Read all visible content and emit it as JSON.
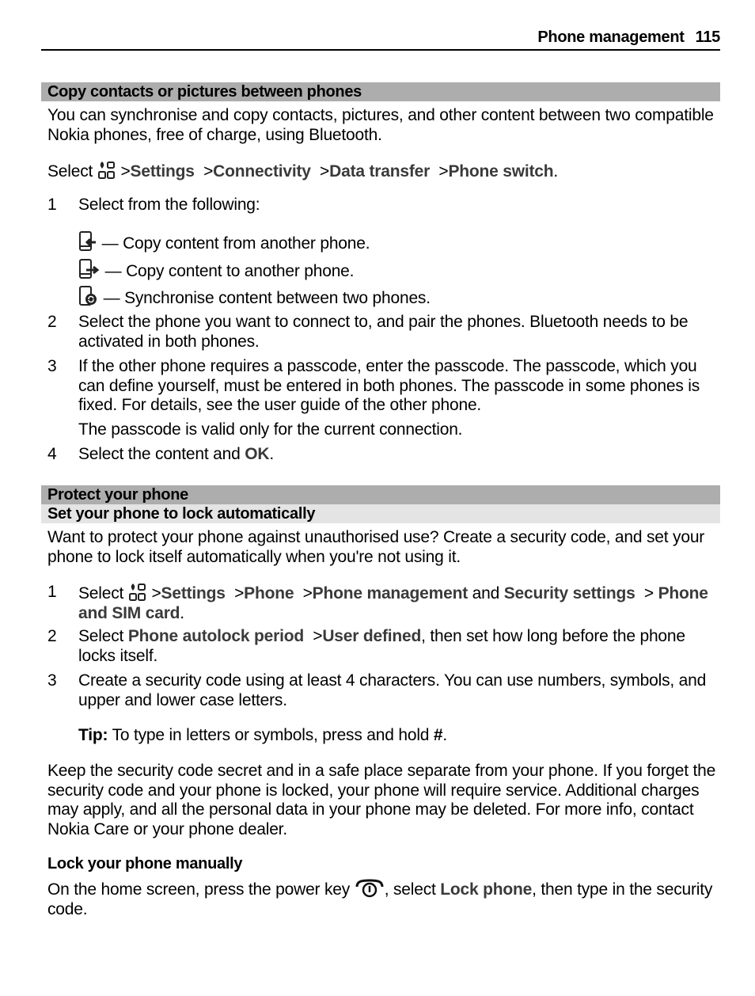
{
  "header": {
    "section": "Phone management",
    "page_number": "115"
  },
  "section1": {
    "title": "Copy contacts or pictures between phones",
    "intro": "You can synchronise and copy contacts, pictures, and other content between two compatible Nokia phones, free of charge, using Bluetooth.",
    "path": {
      "prefix": "Select",
      "icon": "menu-grid-icon",
      "items": [
        "Settings",
        "Connectivity",
        "Data transfer",
        "Phone switch"
      ],
      "suffix": "."
    },
    "steps": [
      {
        "n": "1",
        "text": "Select from the following:"
      },
      {
        "n": "2",
        "text": "Select the phone you want to connect to, and pair the phones. Bluetooth needs to be activated in both phones."
      },
      {
        "n": "3",
        "text": "If the other phone requires a passcode, enter the passcode. The passcode, which you can define yourself, must be entered in both phones. The passcode in some phones is fixed. For details, see the user guide of the other phone.",
        "note": "The passcode is valid only for the current connection."
      },
      {
        "n": "4",
        "text": "Select the content and ",
        "ui": "OK",
        "suffix": "."
      }
    ],
    "options": [
      {
        "icon": "copy-from-phone-icon",
        "text": "— Copy content from another phone."
      },
      {
        "icon": "copy-to-phone-icon",
        "text": "— Copy content to another phone."
      },
      {
        "icon": "sync-phones-icon",
        "text": "— Synchronise content between two phones."
      }
    ]
  },
  "section2": {
    "title": "Protect your phone",
    "subtitle": "Set your phone to lock automatically",
    "intro": "Want to protect your phone against unauthorised use? Create a security code, and set your phone to lock itself automatically when you're not using it.",
    "steps": [
      {
        "n": "1",
        "prefix": "Select",
        "items": [
          "Settings",
          "Phone",
          "Phone management"
        ],
        "and": "and",
        "item4": "Security settings",
        "item5": "Phone and SIM card",
        "suffix": "."
      },
      {
        "n": "2",
        "prefix": "Select",
        "item1": "Phone autolock period",
        "item2": "User defined",
        "text": ", then set how long before the phone locks itself."
      },
      {
        "n": "3",
        "text": "Create a security code using at least 4 characters. You can use numbers, symbols, and upper and lower case letters."
      }
    ],
    "tip": {
      "label": "Tip:",
      "text": " To type in letters or symbols, press and hold ",
      "key": "#",
      "suffix": "."
    },
    "warning": "Keep the security code secret and in a safe place separate from your phone. If you forget the security code and your phone is locked, your phone will require service. Additional charges may apply, and all the personal data in your phone may be deleted. For more info, contact Nokia Care or your phone dealer.",
    "manual": {
      "title": "Lock your phone manually",
      "text1": "On the home screen, press the power key ",
      "text2": ", select ",
      "ui": "Lock phone",
      "text3": ", then type in the security code."
    }
  },
  "sep": ">"
}
